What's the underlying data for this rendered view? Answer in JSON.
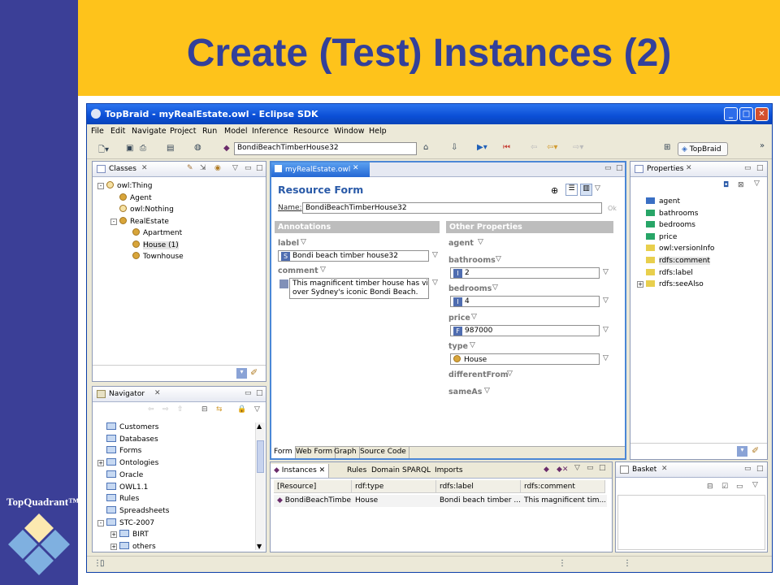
{
  "slide": {
    "title": "Create (Test) Instances (2)",
    "logo_text": "TopQuadrant™",
    "colors": {
      "sidebar": "#3b3f97",
      "header": "#fec31b",
      "title": "#33409a"
    }
  },
  "window": {
    "title": "TopBraid - myRealEstate.owl - Eclipse SDK",
    "menu": [
      "File",
      "Edit",
      "Navigate",
      "Project",
      "Run",
      "Model",
      "Inference",
      "Resource",
      "Window",
      "Help"
    ],
    "toolbar": {
      "resource_value": "BondiBeachTimberHouse32",
      "perspective_label": "TopBraid"
    }
  },
  "classes": {
    "tab_label": "Classes",
    "tree": [
      {
        "label": "owl:Thing",
        "level": 0,
        "expander": "-",
        "icon": "pale-ball"
      },
      {
        "label": "Agent",
        "level": 1,
        "expander": "",
        "icon": "ball"
      },
      {
        "label": "owl:Nothing",
        "level": 1,
        "expander": "",
        "icon": "pale-ball"
      },
      {
        "label": "RealEstate",
        "level": 1,
        "expander": "-",
        "icon": "ball"
      },
      {
        "label": "Apartment",
        "level": 2,
        "expander": "",
        "icon": "ball"
      },
      {
        "label": "House  (1)",
        "level": 2,
        "expander": "",
        "icon": "ball",
        "selected": true
      },
      {
        "label": "Townhouse",
        "level": 2,
        "expander": "",
        "icon": "ball"
      }
    ]
  },
  "navigator": {
    "tab_label": "Navigator",
    "items": [
      {
        "label": "Customers",
        "level": 0,
        "expander": ""
      },
      {
        "label": "Databases",
        "level": 0,
        "expander": ""
      },
      {
        "label": "Forms",
        "level": 0,
        "expander": ""
      },
      {
        "label": "Ontologies",
        "level": 0,
        "expander": "+"
      },
      {
        "label": "Oracle",
        "level": 0,
        "expander": ""
      },
      {
        "label": "OWL1.1",
        "level": 0,
        "expander": ""
      },
      {
        "label": "Rules",
        "level": 0,
        "expander": ""
      },
      {
        "label": "Spreadsheets",
        "level": 0,
        "expander": ""
      },
      {
        "label": "STC-2007",
        "level": 0,
        "expander": "-"
      },
      {
        "label": "BIRT",
        "level": 1,
        "expander": "+"
      },
      {
        "label": "others",
        "level": 1,
        "expander": "+"
      }
    ]
  },
  "editor": {
    "tab_label": "myRealEstate.owl",
    "form_title": "Resource Form",
    "name_label": "Name:",
    "name_value": "BondiBeachTimberHouse32",
    "ok_label": "Ok",
    "annotations_header": "Annotations",
    "label_field": {
      "label": "label",
      "type": "S",
      "value": "Bondi beach timber house32"
    },
    "comment_field": {
      "label": "comment",
      "value_line1": "This magnificent timber house has views",
      "value_line2": "over Sydney's iconic Bondi Beach."
    },
    "other_header": "Other Properties",
    "props": {
      "agent": "agent",
      "bathrooms": {
        "label": "bathrooms",
        "type": "I",
        "value": "2"
      },
      "bedrooms": {
        "label": "bedrooms",
        "type": "I",
        "value": "4"
      },
      "price": {
        "label": "price",
        "type": "F",
        "value": "987000"
      },
      "type": {
        "label": "type",
        "value": "House"
      },
      "differentFrom": "differentFrom",
      "sameAs": "sameAs"
    },
    "bottom_tabs": [
      "Form",
      "Web Form",
      "Graph",
      "Source Code"
    ]
  },
  "properties": {
    "tab_label": "Properties",
    "items": [
      {
        "label": "agent",
        "color": "#3a6fc4"
      },
      {
        "label": "bathrooms",
        "color": "#27a567"
      },
      {
        "label": "bedrooms",
        "color": "#27a567"
      },
      {
        "label": "price",
        "color": "#27a567"
      },
      {
        "label": "owl:versionInfo",
        "color": "#e8cf4d"
      },
      {
        "label": "rdfs:comment",
        "color": "#e8cf4d",
        "selected": true
      },
      {
        "label": "rdfs:label",
        "color": "#e8cf4d"
      },
      {
        "label": "rdfs:seeAlso",
        "color": "#e8cf4d",
        "expander": "+"
      }
    ]
  },
  "instances": {
    "tabs": [
      "Instances",
      "Rules",
      "Domain",
      "SPARQL",
      "Imports"
    ],
    "columns": [
      "[Resource]",
      "rdf:type",
      "rdfs:label",
      "rdfs:comment"
    ],
    "rows": [
      [
        "BondiBeachTimbe...",
        "House",
        "Bondi beach timber ...",
        "This magnificent tim..."
      ]
    ]
  },
  "basket": {
    "tab_label": "Basket"
  }
}
